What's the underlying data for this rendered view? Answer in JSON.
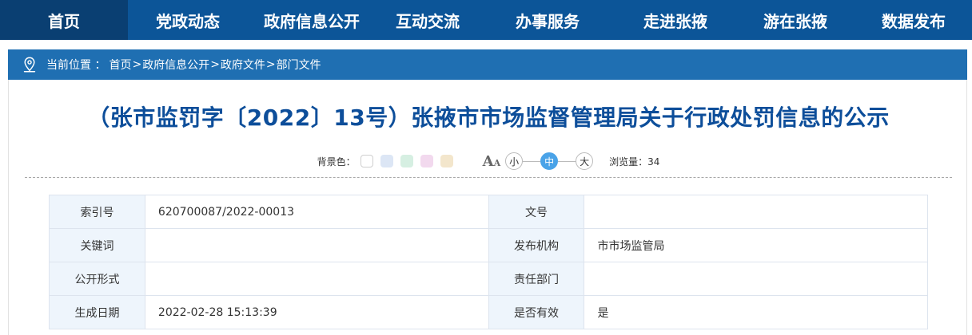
{
  "nav": {
    "items": [
      {
        "label": "首页",
        "active": true
      },
      {
        "label": "党政动态"
      },
      {
        "label": "政府信息公开"
      },
      {
        "label": "互动交流"
      },
      {
        "label": "办事服务"
      },
      {
        "label": "走进张掖"
      },
      {
        "label": "游在张掖"
      },
      {
        "label": "数据发布"
      }
    ]
  },
  "breadcrumb": {
    "icon": "location-pin-icon",
    "prefix": "当前位置 ：",
    "items": [
      "首页",
      "政府信息公开",
      "政府文件",
      "部门文件"
    ],
    "separator": ">"
  },
  "article": {
    "title": "（张市监罚字〔2022〕13号）张掖市市场监督管理局关于行政处罚信息的公示"
  },
  "toolbar": {
    "bg_label": "背景色：",
    "swatches": [
      "#ffffff",
      "#dce6f5",
      "#d6efe2",
      "#f2d9ee",
      "#f3e6cc"
    ],
    "font_icon": "font-size-icon",
    "sizes": [
      "小",
      "中",
      "大"
    ],
    "active_size": "中",
    "views_label": "浏览量：",
    "views_value": "34"
  },
  "info_table": {
    "rows": [
      {
        "l1": "索引号",
        "v1": "620700087/2022-00013",
        "l2": "文号",
        "v2": ""
      },
      {
        "l1": "关键词",
        "v1": "",
        "l2": "发布机构",
        "v2": "市市场监管局"
      },
      {
        "l1": "公开形式",
        "v1": "",
        "l2": "责任部门",
        "v2": ""
      },
      {
        "l1": "生成日期",
        "v1": "2022-02-28 15:13:39",
        "l2": "是否有效",
        "v2": "是"
      }
    ]
  },
  "colors": {
    "nav_bg": "#0c5598",
    "nav_active": "#0a3f72",
    "breadcrumb_bg": "#1f6fb2",
    "title": "#0d4e9a",
    "label_cell_bg": "#eef5fc",
    "size_active": "#4aa3e8"
  }
}
